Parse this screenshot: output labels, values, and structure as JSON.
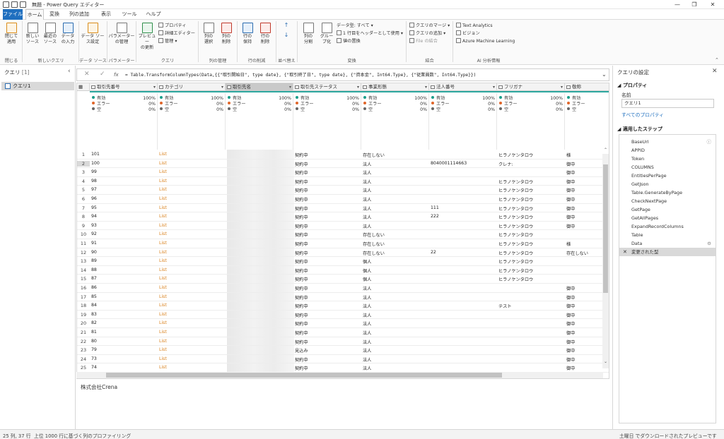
{
  "window": {
    "title": "無題 - Power Query エディター",
    "controls": [
      "—",
      "❐",
      "✕"
    ]
  },
  "menu": {
    "file": "ファイル",
    "tabs": [
      "ホーム",
      "変換",
      "列の追加",
      "表示",
      "ツール",
      "ヘルプ"
    ]
  },
  "ribbon": {
    "close_apply": "閉じて\n適用",
    "new_source": "新しい\nソース",
    "recent_sources": "最近の\nソース",
    "enter_data": "データ\nの入力",
    "data_source_settings": "データ ソー\nス設定",
    "manage_parameters": "パラメーター\nの管理",
    "refresh_preview": "プレビュー\nの更新",
    "properties": "プロパティ",
    "advanced_editor": "詳細エディター",
    "manage": "管理",
    "choose_columns": "列の\n選択",
    "remove_columns": "列の\n削除",
    "keep_rows": "行の\n保持",
    "remove_rows": "行の\n削除",
    "split_column": "列の\n分割",
    "group_by": "グルー\nプ化",
    "data_type": "データ型: すべて",
    "first_row_header": "1 行目をヘッダーとして使用",
    "replace_values": "値の置換",
    "merge_queries": "クエリのマージ",
    "append_queries": "クエリの追加",
    "combine_files": "File の結合",
    "text_analytics": "Text Analytics",
    "vision": "ビジョン",
    "azure_ml": "Azure Machine Learning",
    "groups": [
      "閉じる",
      "新しいクエリ",
      "データ ソース",
      "パラメーター",
      "クエリ",
      "列の管理",
      "行の削減",
      "並べ替え",
      "変換",
      "結合",
      "AI 分析情報"
    ]
  },
  "queries_pane": {
    "title": "クエリ",
    "count": "[1]",
    "items": [
      "クエリ1"
    ]
  },
  "formula_bar": {
    "fx": "fx",
    "formula": "= Table.TransformColumnTypes(Data,{{\"取引開始日\", type date}, {\"取引終了日\", type date}, {\"資本金\", Int64.Type}, {\"従業員数\", Int64.Type}})"
  },
  "grid": {
    "columns": [
      "取引先番号",
      "カテゴリ",
      "取引先名",
      "取引先ステータス",
      "事業形態",
      "法人番号",
      "フリガナ",
      "敬称"
    ],
    "profile_labels": [
      "有効",
      "エラー",
      "空"
    ],
    "profiles": [
      [
        "100%",
        "0%",
        "0%"
      ],
      [
        "100%",
        "0%",
        "0%"
      ],
      [
        "100%",
        "0%",
        "0%"
      ],
      [
        "100%",
        "0%",
        "0%"
      ],
      [
        "100%",
        "0%",
        "0%"
      ],
      [
        "100%",
        "0%",
        "0%"
      ],
      [
        "100%",
        "0%",
        "0%"
      ],
      [
        "",
        "",
        ""
      ]
    ],
    "rows": [
      {
        "n": "1",
        "c": [
          "101",
          "List",
          "",
          "契約中",
          "存在しない",
          "",
          "ヒラノケンタロウ",
          "様"
        ]
      },
      {
        "n": "2",
        "c": [
          "100",
          "List",
          "",
          "契約中",
          "法人",
          "8040001114663",
          "クレナ:",
          "御中"
        ]
      },
      {
        "n": "3",
        "c": [
          "99",
          "List",
          "",
          "契約中",
          "法人",
          "",
          "",
          "御中"
        ]
      },
      {
        "n": "4",
        "c": [
          "98",
          "List",
          "",
          "契約中",
          "法人",
          "",
          "ヒラノケンタロウ",
          "御中"
        ]
      },
      {
        "n": "5",
        "c": [
          "97",
          "List",
          "",
          "契約中",
          "法人",
          "",
          "ヒラノケンタロウ",
          "御中"
        ]
      },
      {
        "n": "6",
        "c": [
          "96",
          "List",
          "",
          "契約中",
          "法人",
          "",
          "ヒラノケンタロウ",
          "御中"
        ]
      },
      {
        "n": "7",
        "c": [
          "95",
          "List",
          "",
          "契約中",
          "法人",
          "111",
          "ヒラノケンタロウ",
          "御中"
        ]
      },
      {
        "n": "8",
        "c": [
          "94",
          "List",
          "",
          "契約中",
          "法人",
          "222",
          "ヒラノケンタロウ",
          "御中"
        ]
      },
      {
        "n": "9",
        "c": [
          "93",
          "List",
          "",
          "契約中",
          "法人",
          "",
          "ヒラノケンタロウ",
          "御中"
        ]
      },
      {
        "n": "10",
        "c": [
          "92",
          "List",
          "",
          "契約中",
          "存在しない",
          "",
          "ヒラノケンタロウ",
          ""
        ]
      },
      {
        "n": "11",
        "c": [
          "91",
          "List",
          "",
          "契約中",
          "存在しない",
          "",
          "ヒラノケンタロウ",
          "様"
        ]
      },
      {
        "n": "12",
        "c": [
          "90",
          "List",
          "",
          "契約中",
          "存在しない",
          "22",
          "ヒラノケンタロウ",
          "存在しない"
        ]
      },
      {
        "n": "13",
        "c": [
          "89",
          "List",
          "",
          "契約中",
          "個人",
          "",
          "ヒラノケンタロウ",
          ""
        ]
      },
      {
        "n": "14",
        "c": [
          "88",
          "List",
          "",
          "契約中",
          "個人",
          "",
          "ヒラノケンタロウ",
          ""
        ]
      },
      {
        "n": "15",
        "c": [
          "87",
          "List",
          "",
          "契約中",
          "個人",
          "",
          "ヒラノケンタロウ",
          ""
        ]
      },
      {
        "n": "16",
        "c": [
          "86",
          "List",
          "",
          "契約中",
          "法人",
          "",
          "",
          "御中"
        ]
      },
      {
        "n": "17",
        "c": [
          "85",
          "List",
          "",
          "契約中",
          "法人",
          "",
          "",
          "御中"
        ]
      },
      {
        "n": "18",
        "c": [
          "84",
          "List",
          "",
          "契約中",
          "法人",
          "",
          "テスト",
          "御中"
        ]
      },
      {
        "n": "19",
        "c": [
          "83",
          "List",
          "",
          "契約中",
          "法人",
          "",
          "",
          "御中"
        ]
      },
      {
        "n": "20",
        "c": [
          "82",
          "List",
          "",
          "契約中",
          "法人",
          "",
          "",
          "御中"
        ]
      },
      {
        "n": "21",
        "c": [
          "81",
          "List",
          "",
          "契約中",
          "法人",
          "",
          "",
          "御中"
        ]
      },
      {
        "n": "22",
        "c": [
          "80",
          "List",
          "",
          "契約中",
          "法人",
          "",
          "",
          "御中"
        ]
      },
      {
        "n": "23",
        "c": [
          "79",
          "List",
          "",
          "見込み",
          "法人",
          "",
          "",
          "御中"
        ]
      },
      {
        "n": "24",
        "c": [
          "73",
          "List",
          "",
          "契約中",
          "法人",
          "",
          "",
          "御中"
        ]
      },
      {
        "n": "25",
        "c": [
          "74",
          "List",
          "",
          "契約中",
          "法人",
          "",
          "",
          "御中"
        ]
      }
    ]
  },
  "below_grid_text": "株式会社Crena",
  "settings_pane": {
    "title": "クエリの設定",
    "properties_header": "プロパティ",
    "name_label": "名前",
    "name_value": "クエリ1",
    "all_properties": "すべてのプロパティ",
    "applied_steps_header": "適用したステップ",
    "steps": [
      "BaseUrl",
      "APPID",
      "Token",
      "COLUMNS",
      "EntitiesPerPage",
      "GetJson",
      "Table.GenerateByPage",
      "CheckNextPage",
      "GetPage",
      "GetAllPages",
      "ExpandRecordColumns",
      "Table",
      "Data",
      "変更された型"
    ]
  },
  "status": {
    "left": "25 列, 37 行",
    "profiling": "上位 1000 行に基づく列のプロファイリング",
    "right": "土曜日 でダウンロードされたプレビューです"
  },
  "colors": {
    "accent": "#1f6fbf",
    "quality_bar": "#2da89f",
    "list_text": "#d9821e",
    "valid_dot": "#1b9e8a",
    "error_dot": "#e0662a"
  }
}
